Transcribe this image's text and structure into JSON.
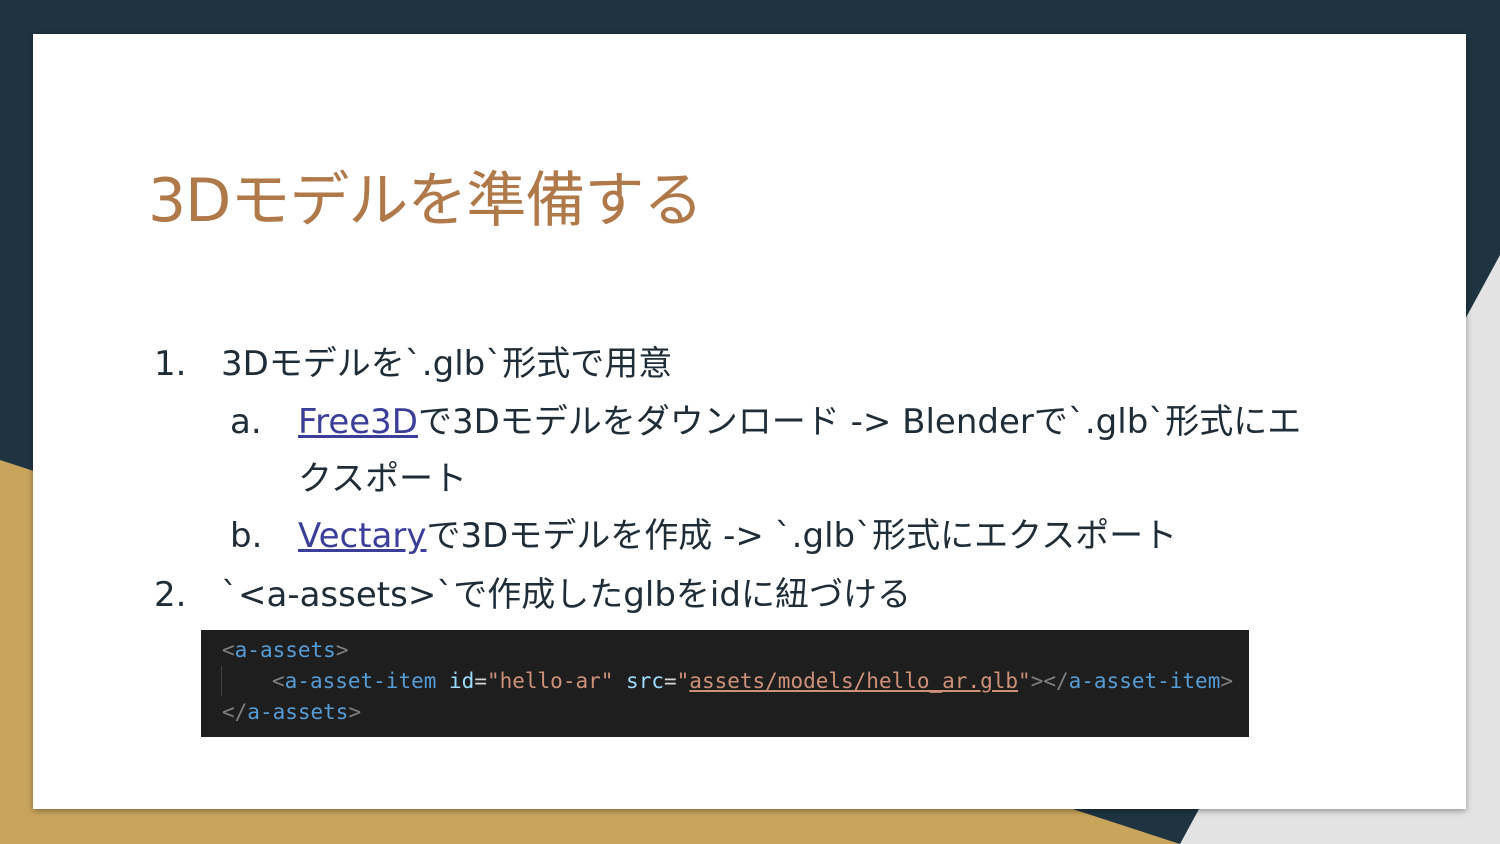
{
  "slide": {
    "title": "3Dモデルを準備する",
    "items": [
      {
        "marker": "1.",
        "text": "3Dモデルを`.glb`形式で用意"
      },
      {
        "marker": "a.",
        "link": "Free3D",
        "text": "で3Dモデルをダウンロード -> Blenderで`.glb`形式にエ",
        "text_cont": "クスポート"
      },
      {
        "marker": "b.",
        "link": "Vectary",
        "text": "で3Dモデルを作成 -> `.glb`形式にエクスポート"
      },
      {
        "marker": "2.",
        "text": "`<a-assets>`で作成したglbをidに紐づける"
      }
    ],
    "code": {
      "line1": {
        "open": "<",
        "tag": "a-assets",
        "close": ">"
      },
      "line2": {
        "open": "<",
        "tag": "a-asset-item",
        "attr1": " id",
        "eq1": "=",
        "val1": "\"hello-ar\"",
        "attr2": " src",
        "eq2": "=",
        "q_open": "\"",
        "url": "assets/models/hello_ar.glb",
        "q_close": "\"",
        "close": "></",
        "end_tag": "a-asset-item",
        "end_close": ">"
      },
      "line3": {
        "open": "</",
        "tag": "a-assets",
        "close": ">"
      }
    }
  },
  "colors": {
    "title": "#b0794a",
    "text": "#1f2d38",
    "link": "#3b3f9a",
    "background_dark": "#1e3441",
    "background_gold": "#c9a55c",
    "code_bg": "#1e1e1e"
  }
}
